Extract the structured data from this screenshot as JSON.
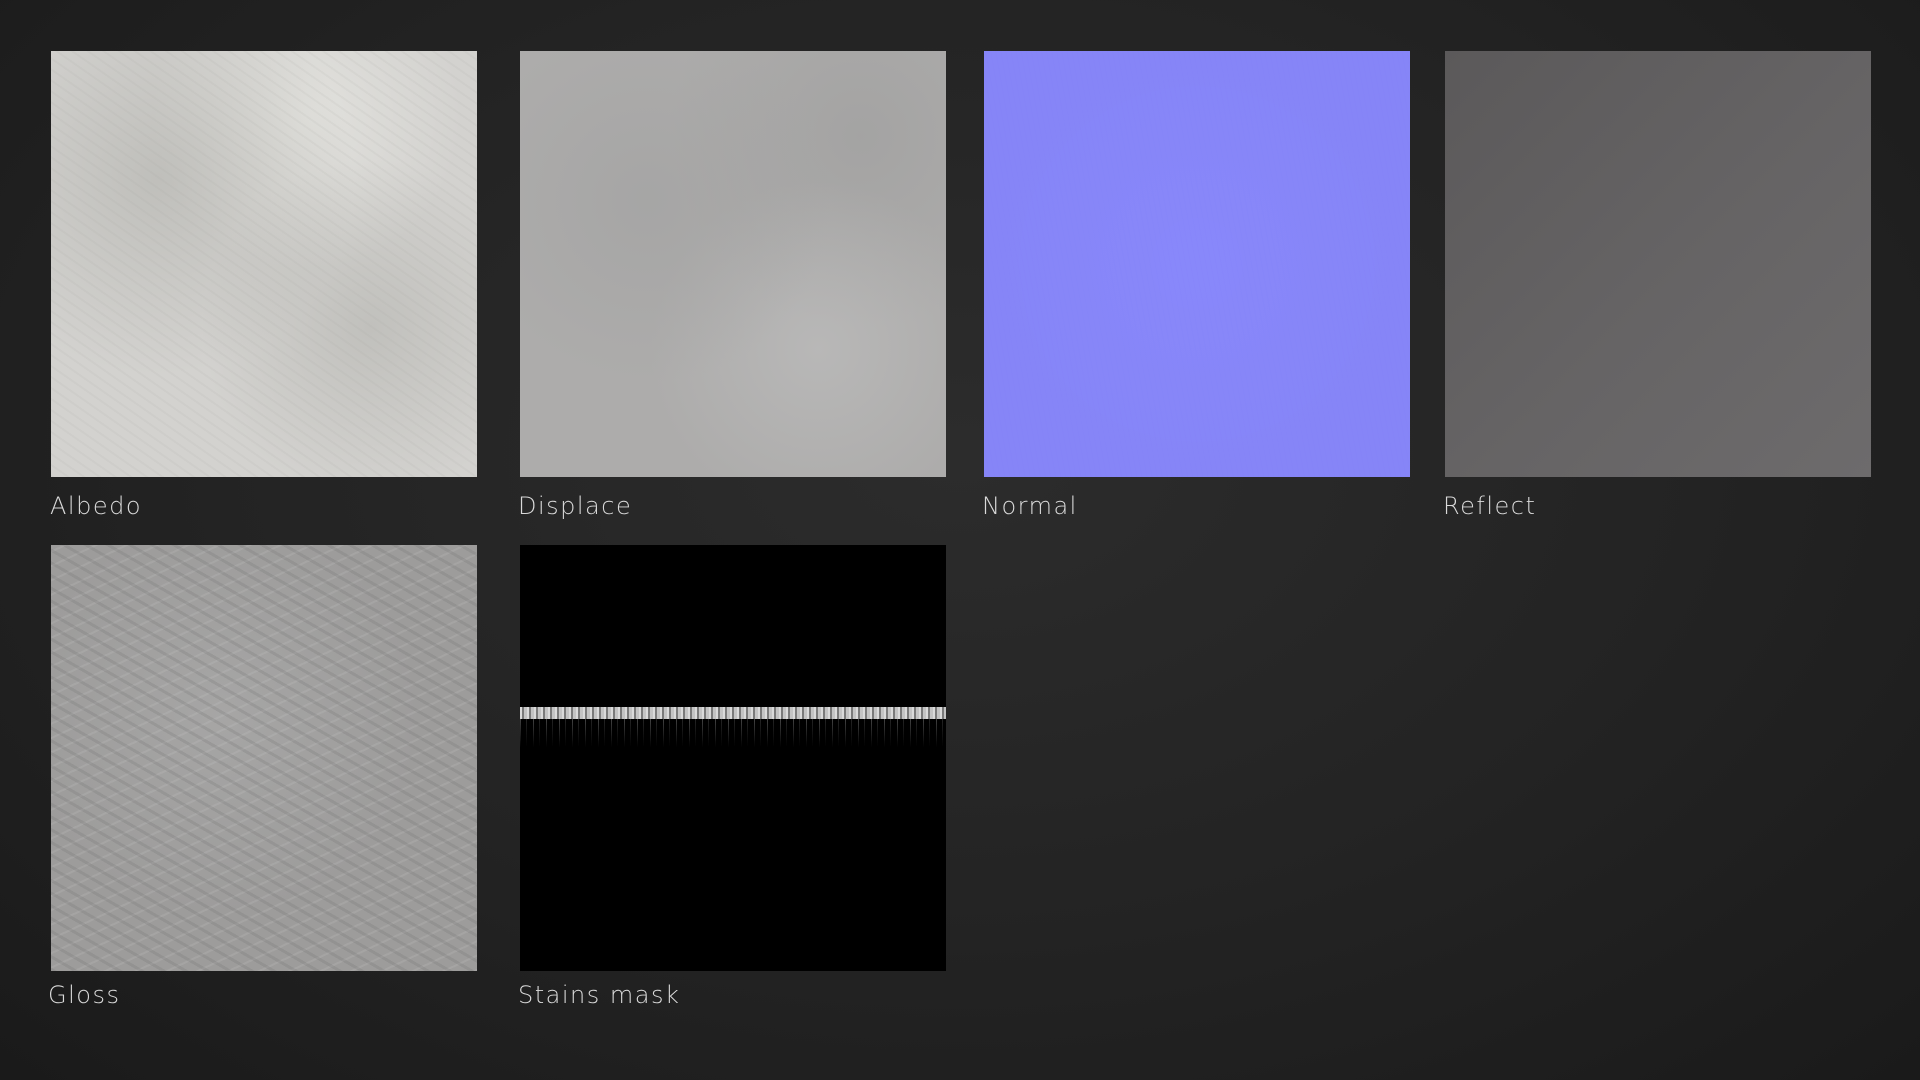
{
  "maps": [
    {
      "label": "Albedo",
      "swatch_color": "#d3d2cf"
    },
    {
      "label": "Displace",
      "swatch_color": "#adacab"
    },
    {
      "label": "Normal",
      "swatch_color": "#8685f7"
    },
    {
      "label": "Reflect",
      "swatch_color": "#636162"
    },
    {
      "label": "Gloss",
      "swatch_color": "#9d9c9b"
    },
    {
      "label": "Stains mask",
      "swatch_color": "#000000"
    }
  ],
  "background_color": "#232323",
  "label_color": "#dadada"
}
